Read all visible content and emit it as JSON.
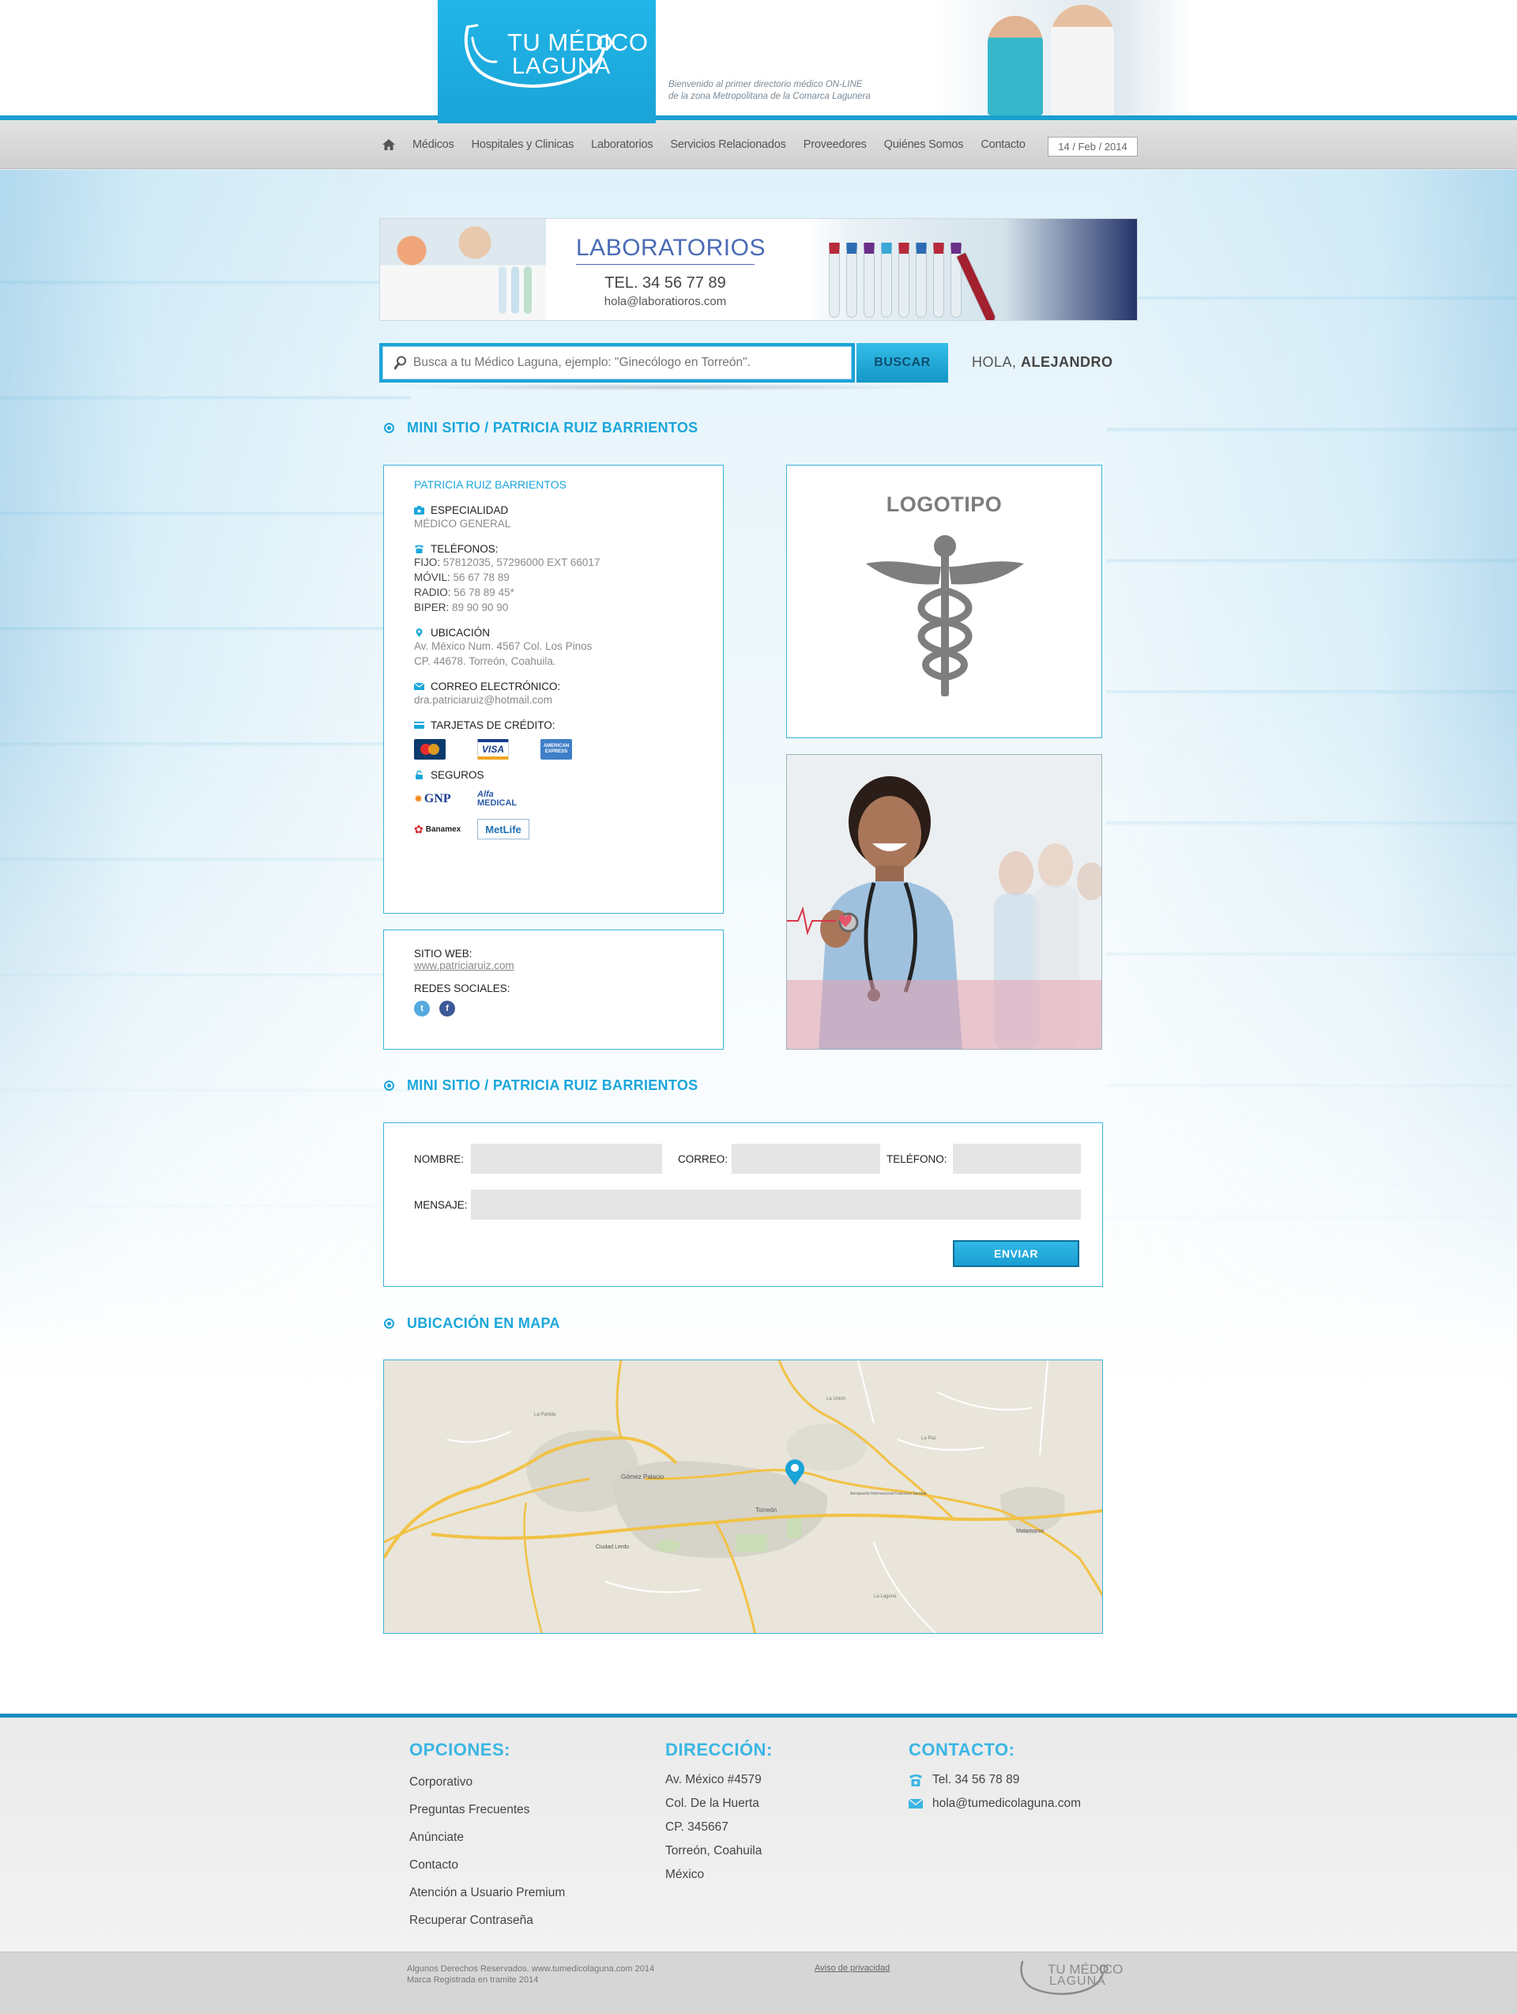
{
  "brand": {
    "name_line1": "TU MÉDICO",
    "name_line2": "LAGUNA",
    "tagline_line1": "Bienvenido al primer directorio médico ON-LINE",
    "tagline_line2": "de la zona Metropolitana de la Comarca Lagunera"
  },
  "nav": {
    "home_icon": "home-icon",
    "items": [
      "Médicos",
      "Hospitales y Clinicas",
      "Laboratorios",
      "Servicios Relacionados",
      "Proveedores",
      "Quiénes Somos",
      "Contacto"
    ],
    "date": "14 / Feb / 2014"
  },
  "banner": {
    "title": "LABORATORIOS",
    "tel": "TEL. 34 56 77 89",
    "email": "hola@laboratioros.com"
  },
  "search": {
    "placeholder": "Busca a tu Médico Laguna, ejemplo: \"Ginecólogo en Torreón\".",
    "button": "BUSCAR",
    "greeting_prefix": "HOLA, ",
    "greeting_name": "ALEJANDRO"
  },
  "sections": {
    "mini_site_1": "MINI SITIO / PATRICIA RUIZ BARRIENTOS",
    "mini_site_2": "MINI SITIO / PATRICIA RUIZ BARRIENTOS",
    "map": "UBICACIÓN EN MAPA"
  },
  "profile": {
    "name": "PATRICIA RUIZ BARRIENTOS",
    "specialty_label": "ESPECIALIDAD",
    "specialty": "MÉDICO GENERAL",
    "phones_label": "TELÉFONOS:",
    "phones": [
      {
        "label": "FIJO:",
        "value": " 57812035, 57296000 EXT 66017"
      },
      {
        "label": "MÓVIL:",
        "value": " 56 67 78 89"
      },
      {
        "label": "RADIO:",
        "value": " 56 78 89 45*"
      },
      {
        "label": "BIPER:",
        "value": " 89 90 90 90"
      }
    ],
    "location_label": "UBICACIÓN",
    "location_line1": "Av. México Num. 4567 Col. Los Pinos",
    "location_line2": "CP. 44678. Torreón, Coahuila.",
    "email_label": "CORREO ELECTRÓNICO:",
    "email": "dra.patriciaruiz@hotmail.com",
    "cards_label": "TARJETAS DE CRÉDITO:",
    "cards": [
      "MasterCard",
      "VISA",
      "AMERICAN EXPRESS"
    ],
    "insurance_label": "SEGUROS",
    "insurance": [
      "GNP",
      "Alfa MEDICAL",
      "Banamex",
      "MetLife"
    ]
  },
  "web": {
    "site_label": "SITIO WEB:",
    "site": "www.patriciaruiz.com",
    "social_label": "REDES SOCIALES:",
    "social": [
      "twitter-icon",
      "facebook-icon"
    ]
  },
  "logo_card": {
    "title": "LOGOTIPO"
  },
  "form": {
    "name_label": "NOMBRE:",
    "email_label": "CORREO:",
    "phone_label": "TELÉFONO:",
    "message_label": "MENSAJE:",
    "send": "ENVIAR"
  },
  "map": {
    "labels": [
      "Gómez Palacio",
      "Torreón",
      "Ciudad Lerdo",
      "Matamoros",
      "La Partida",
      "La Unión",
      "Aeropuerto Internacional Francisco Sarabia",
      "La Paz",
      "La Laguna"
    ]
  },
  "footer": {
    "options_title": "OPCIONES:",
    "options": [
      "Corporativo",
      "Preguntas Frecuentes",
      "Anúnciate",
      "Contacto",
      "Atención a Usuario Premium",
      "Recuperar Contraseña"
    ],
    "address_title": "DIRECCIÓN:",
    "address": [
      "Av. México #4579",
      "Col. De la Huerta",
      "CP. 345667",
      "Torreón, Coahuila",
      "México"
    ],
    "contact_title": "CONTACTO:",
    "tel": "Tel. 34 56 78 89",
    "email": "hola@tumedicolaguna.com"
  },
  "bottom": {
    "copy_line1": "Algunos Derechos Reservados. www.tumedicolaguna.com 2014",
    "copy_line2": "Marca Registrada en tramite 2014",
    "privacy": "Aviso de privacidad",
    "logo_line1": "TU MÉDICO",
    "logo_line2": "LAGUNA"
  },
  "colors": {
    "accent": "#1ba6db",
    "nav_bg": "#d8d8d8",
    "footer_title": "#3bb6e3"
  }
}
